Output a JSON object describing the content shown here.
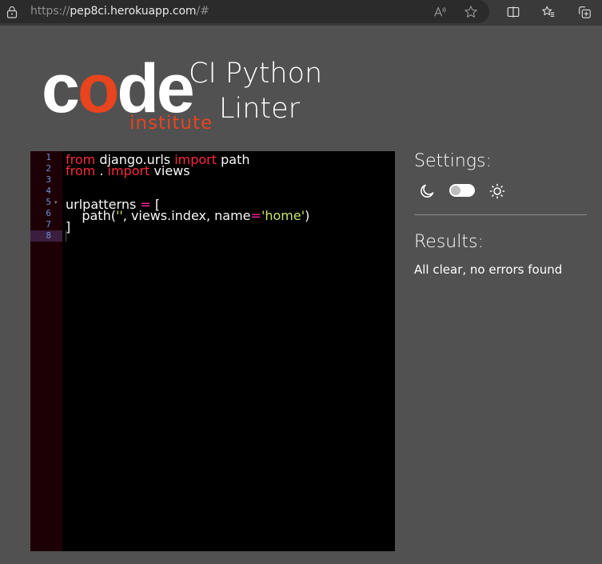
{
  "browser": {
    "url_prefix": "https://",
    "url_host": "pep8ci.herokuapp.com",
    "url_suffix": "/#",
    "icons": [
      "lock-icon",
      "read-aloud-icon",
      "favorite-star-icon",
      "split-screen-icon",
      "favorites-list-icon",
      "collections-icon"
    ]
  },
  "header": {
    "logo_code_c": "c",
    "logo_code_o": "o",
    "logo_code_de": "de",
    "logo_institute": "institute",
    "title_line1": "CI Python",
    "title_line2": "Linter"
  },
  "editor": {
    "lines": [
      {
        "num": "1",
        "tokens": [
          {
            "t": "from",
            "c": "kw"
          },
          {
            "t": " django.urls ",
            "c": ""
          },
          {
            "t": "import",
            "c": "kw"
          },
          {
            "t": " path",
            "c": ""
          }
        ]
      },
      {
        "num": "2",
        "tokens": [
          {
            "t": "from",
            "c": "kw"
          },
          {
            "t": " . ",
            "c": ""
          },
          {
            "t": "import",
            "c": "kw"
          },
          {
            "t": " views",
            "c": ""
          }
        ]
      },
      {
        "num": "3",
        "tokens": []
      },
      {
        "num": "4",
        "tokens": []
      },
      {
        "num": "5",
        "fold": true,
        "tokens": [
          {
            "t": "urlpatterns ",
            "c": ""
          },
          {
            "t": "=",
            "c": "op"
          },
          {
            "t": " [",
            "c": ""
          }
        ]
      },
      {
        "num": "6",
        "tokens": [
          {
            "t": "    path(",
            "c": ""
          },
          {
            "t": "''",
            "c": "str"
          },
          {
            "t": ", views.index, name",
            "c": ""
          },
          {
            "t": "=",
            "c": "op"
          },
          {
            "t": "'home'",
            "c": "str"
          },
          {
            "t": ")",
            "c": ""
          }
        ]
      },
      {
        "num": "7",
        "tokens": [
          {
            "t": "]",
            "c": ""
          }
        ]
      },
      {
        "num": "8",
        "active": true,
        "tokens": []
      }
    ],
    "fold_marker": "▾"
  },
  "settings": {
    "title": "Settings:",
    "theme_toggle_on": false,
    "moon_icon": "moon-icon",
    "sun_icon": "sun-icon"
  },
  "results": {
    "title": "Results:",
    "message": "All clear, no errors found"
  }
}
